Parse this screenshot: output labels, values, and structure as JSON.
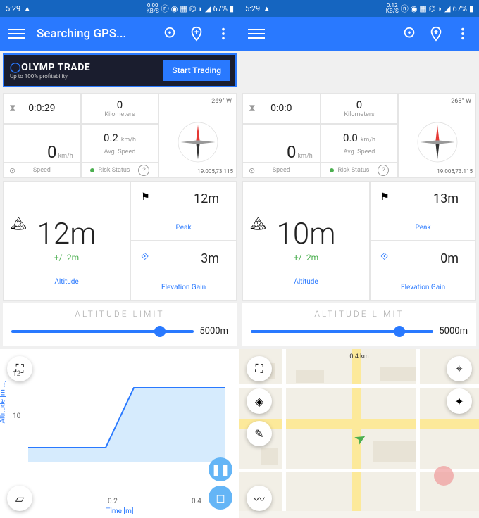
{
  "left": {
    "statusbar": {
      "time": "5:29",
      "data_rate": "0.00",
      "data_unit": "KB/S",
      "battery": "67%"
    },
    "appbar": {
      "title": "Searching GPS..."
    },
    "ad": {
      "title": "OLYMP TRADE",
      "subtitle": "Up to 100% profitability",
      "cta": "Start Trading"
    },
    "timer": "0:0:29",
    "distance": {
      "value": "0",
      "label": "Kilometers"
    },
    "heading": "269° W",
    "coords": "19.005,73.115",
    "speed": {
      "value": "0",
      "unit": "km/h",
      "label": "Speed"
    },
    "avg_speed": {
      "value": "0.2",
      "unit": "km/h",
      "label": "Avg. Speed"
    },
    "risk": "Risk Status",
    "altitude": {
      "value": "12m",
      "accuracy": "+/- 2m",
      "label": "Altitude"
    },
    "peak": {
      "value": "12m",
      "label": "Peak"
    },
    "gain": {
      "value": "3m",
      "label": "Elevation Gain"
    },
    "limit": {
      "title": "ALTITUDE LIMIT",
      "max": "5000m"
    },
    "chart": {
      "ylabel": "Altitude [m ...]",
      "xlabel": "Time [m]",
      "yticks": [
        "12",
        "10"
      ],
      "xticks": [
        "0.2",
        "0.4"
      ]
    }
  },
  "right": {
    "statusbar": {
      "time": "5:29",
      "data_rate": "0.12",
      "data_unit": "KB/S",
      "battery": "67%"
    },
    "timer": "0:0:0",
    "distance": {
      "value": "0",
      "label": "Kilometers"
    },
    "heading": "268° W",
    "coords": "19.005,73.115",
    "speed": {
      "value": "0",
      "unit": "km/h",
      "label": "Speed"
    },
    "avg_speed": {
      "value": "0.0",
      "unit": "km/h",
      "label": "Avg. Speed"
    },
    "risk": "Risk Status",
    "altitude": {
      "value": "10m",
      "accuracy": "+/- 2m",
      "label": "Altitude"
    },
    "peak": {
      "value": "13m",
      "label": "Peak"
    },
    "gain": {
      "value": "0m",
      "label": "Elevation Gain"
    },
    "limit": {
      "title": "ALTITUDE LIMIT",
      "max": "5000m"
    },
    "map": {
      "scale": "0.4 km"
    }
  },
  "chart_data": {
    "type": "line",
    "x": [
      0,
      0.1,
      0.2,
      0.25,
      0.3,
      0.4,
      0.45
    ],
    "y": [
      9,
      9,
      9,
      11,
      12,
      12,
      12
    ],
    "xlabel": "Time [m]",
    "ylabel": "Altitude [m]",
    "ylim": [
      9,
      12
    ],
    "xlim": [
      0,
      0.45
    ]
  }
}
